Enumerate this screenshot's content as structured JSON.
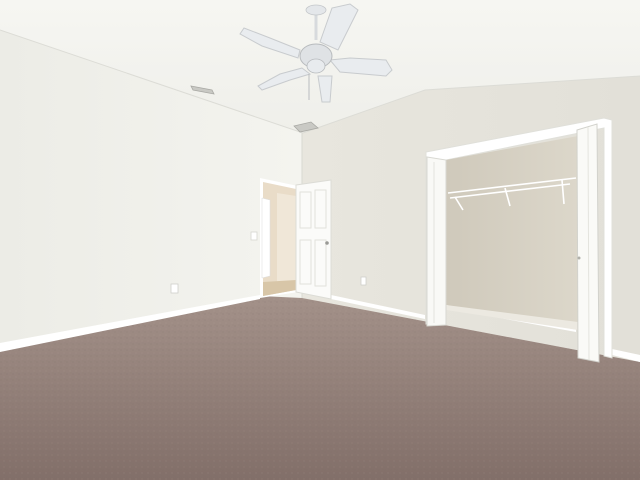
{
  "scene": {
    "subject": "empty-bedroom",
    "features": [
      "vaulted-ceiling",
      "ceiling-fan",
      "hvac-vents",
      "open-interior-door",
      "open-bifold-closet",
      "wire-closet-shelf",
      "carpet-floor",
      "white-baseboards",
      "electrical-outlets"
    ]
  },
  "colors": {
    "ceiling": "#f4f4ef",
    "left_wall": "#efefea",
    "right_wall": "#e6e4dc",
    "closet_interior": "#d8d3c6",
    "carpet": "#8e7e78",
    "trim": "#ffffff",
    "fan": "#e9ecef"
  },
  "icons": [
    "ceiling-fan-icon",
    "air-vent-icon",
    "electrical-outlet-icon",
    "light-switch-icon",
    "door-knob-icon"
  ]
}
